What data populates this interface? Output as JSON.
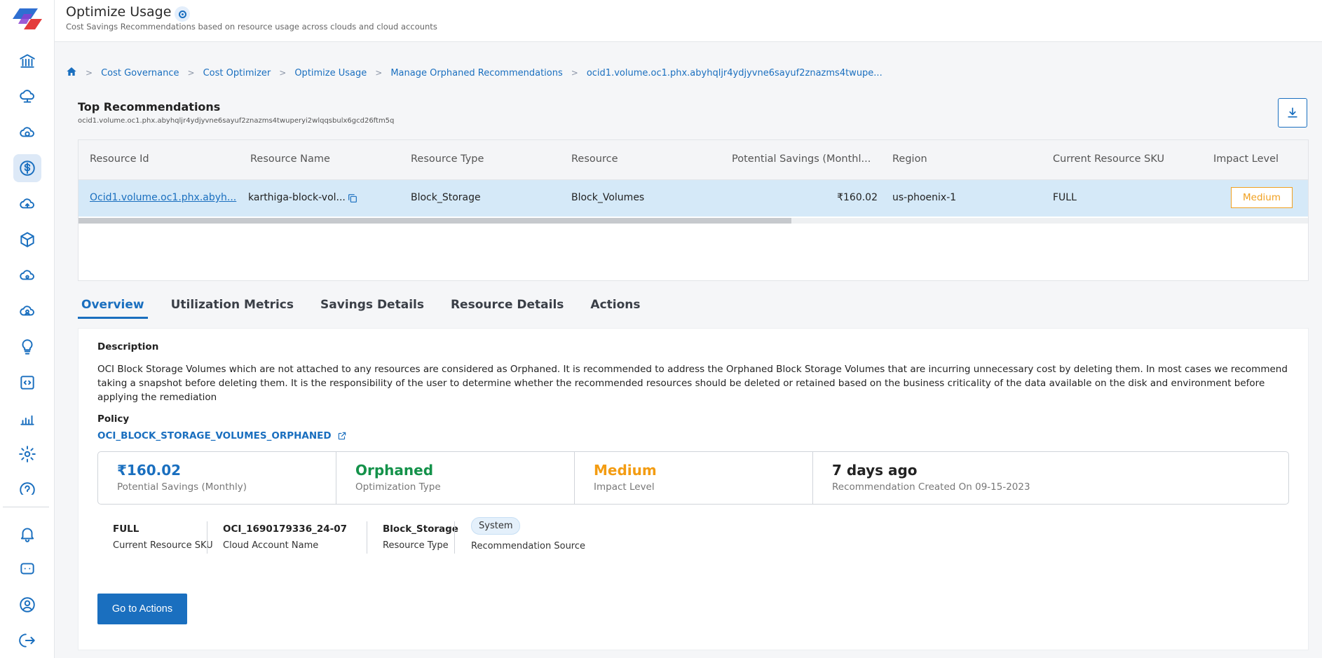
{
  "header": {
    "title": "Optimize Usage",
    "subtitle": "Cost Savings Recommendations based on resource usage across clouds and cloud accounts"
  },
  "breadcrumb": [
    "Cost Governance",
    "Cost Optimizer",
    "Optimize Usage",
    "Manage Orphaned Recommendations",
    "ocid1.volume.oc1.phx.abyhqljr4ydjyvne6sayuf2znazms4twupe..."
  ],
  "recommendation": {
    "title": "Top Recommendations",
    "resource_id_full": "ocid1.volume.oc1.phx.abyhqljr4ydjyvne6sayuf2znazms4twuperyi2wlqqsbulx6gcd26ftm5q"
  },
  "table": {
    "headers": [
      "Resource Id",
      "Resource Name",
      "Resource Type",
      "Resource",
      "Potential Savings (Monthl...",
      "Region",
      "Current Resource SKU",
      "Impact Level"
    ],
    "row": {
      "resource_id": "Ocid1.volume.oc1.phx.abyh...",
      "resource_name": "karthiga-block-vol...",
      "resource_type": "Block_Storage",
      "resource": "Block_Volumes",
      "savings": "₹160.02",
      "region": "us-phoenix-1",
      "sku": "FULL",
      "impact": "Medium"
    },
    "scroll_fraction": 0.58
  },
  "tabs": [
    "Overview",
    "Utilization Metrics",
    "Savings Details",
    "Resource Details",
    "Actions"
  ],
  "overview": {
    "description_label": "Description",
    "description": "OCI Block Storage Volumes which are not attached to any resources are considered as Orphaned. It is recommended to address the Orphaned Block Storage Volumes that are incurring unnecessary cost by deleting them. In most cases we recommend taking a snapshot before deleting them. It is the responsibility of the user to determine whether the recommended resources should be deleted or retained based on the business criticality of the data available on the disk and environment before applying the remediation",
    "policy_label": "Policy",
    "policy_name": "OCI_BLOCK_STORAGE_VOLUMES_ORPHANED",
    "stats": [
      {
        "value": "₹160.02",
        "label": "Potential Savings (Monthly)",
        "color": "#1a6fbf"
      },
      {
        "value": "Orphaned",
        "label": "Optimization Type",
        "color": "#14924a"
      },
      {
        "value": "Medium",
        "label": "Impact Level",
        "color": "#f39c12"
      },
      {
        "value": "7 days ago",
        "label": "Recommendation Created On 09-15-2023",
        "color": "#222222"
      }
    ],
    "meta": [
      {
        "value": "FULL",
        "label": "Current Resource SKU"
      },
      {
        "value": "OCI_1690179336_24-07",
        "label": "Cloud Account Name"
      },
      {
        "value": "Block_Storage",
        "label": "Resource Type"
      },
      {
        "value": "System",
        "label": "Recommendation Source"
      }
    ],
    "action_button": "Go to Actions"
  },
  "sidebar": {
    "icons": [
      "bank-icon",
      "cloud-network-icon",
      "cloud-sync-icon",
      "dollar-icon",
      "cloud-upload-icon",
      "cube-icon",
      "cloud-settings-icon",
      "cloud-user-icon",
      "lightbulb-icon",
      "code-file-icon",
      "bar-chart-icon",
      "gear-icon",
      "help-icon",
      "bell-icon",
      "chat-icon",
      "user-icon",
      "logout-icon"
    ],
    "active": "dollar-icon"
  },
  "colors": {
    "accent": "#1a6fbf",
    "selected_row": "#d5e9f8",
    "impact_medium": "#f0a020"
  }
}
